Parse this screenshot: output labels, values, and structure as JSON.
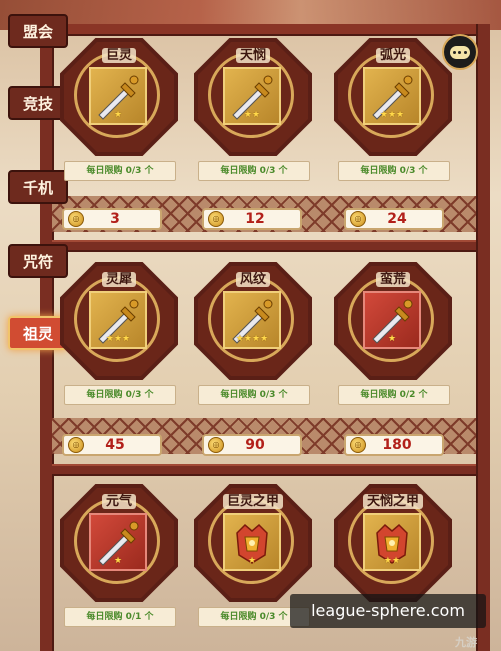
{
  "tabs": [
    {
      "label": "盟会",
      "active": false
    },
    {
      "label": "竞技",
      "active": false
    },
    {
      "label": "千机",
      "active": false
    },
    {
      "label": "咒符",
      "active": false
    },
    {
      "label": "祖灵",
      "active": true
    }
  ],
  "items": [
    {
      "name": "巨灵",
      "stars": "★",
      "limit": "每日限购 0/3 个",
      "price": "3",
      "icon": "sword-icon",
      "bg": "gold"
    },
    {
      "name": "天悯",
      "stars": "★★",
      "limit": "每日限购 0/3 个",
      "price": "12",
      "icon": "sword-icon",
      "bg": "gold"
    },
    {
      "name": "弧光",
      "stars": "★★★",
      "limit": "每日限购 0/3 个",
      "price": "24",
      "icon": "sword-icon",
      "bg": "gold"
    },
    {
      "name": "灵犀",
      "stars": "★★★",
      "limit": "每日限购 0/3 个",
      "price": "45",
      "icon": "sword-icon",
      "bg": "gold"
    },
    {
      "name": "风纹",
      "stars": "★★★★",
      "limit": "每日限购 0/3 个",
      "price": "90",
      "icon": "sword-icon",
      "bg": "gold"
    },
    {
      "name": "蛮荒",
      "stars": "★",
      "limit": "每日限购 0/2 个",
      "price": "180",
      "icon": "sword-icon",
      "bg": "red"
    },
    {
      "name": "元气",
      "stars": "★",
      "limit": "每日限购 0/1 个",
      "icon": "sword-icon",
      "bg": "red"
    },
    {
      "name": "巨灵之甲",
      "stars": "★",
      "limit": "每日限购 0/3 个",
      "icon": "armor-icon",
      "bg": "gold"
    },
    {
      "name": "天悯之甲",
      "stars": "★★",
      "limit": "",
      "icon": "armor-icon",
      "bg": "gold"
    }
  ],
  "watermark": "league-sphere.com",
  "corner_logo": "九游",
  "colors": {
    "price": "#b2201a",
    "limit": "#4a8a2a",
    "frame": "#7a2e22"
  }
}
